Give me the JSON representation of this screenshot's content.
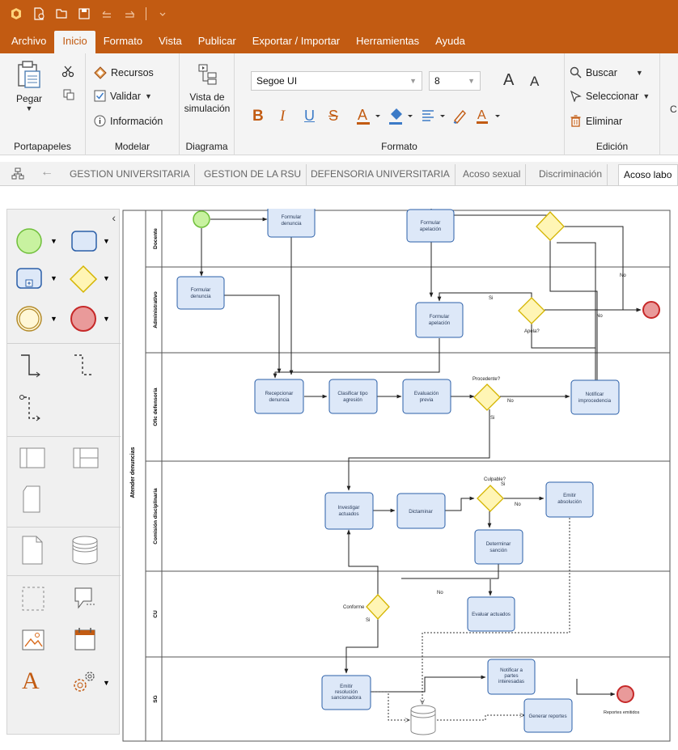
{
  "menu": {
    "items": [
      "Archivo",
      "Inicio",
      "Formato",
      "Vista",
      "Publicar",
      "Exportar / Importar",
      "Herramientas",
      "Ayuda"
    ],
    "active": "Inicio"
  },
  "ribbon": {
    "portapapeles": {
      "paste": "Pegar",
      "label": "Portapapeles"
    },
    "modelar": {
      "recursos": "Recursos",
      "validar": "Validar",
      "informacion": "Información",
      "label": "Modelar"
    },
    "diagrama": {
      "vista_line1": "Vista de",
      "vista_line2": "simulación",
      "label": "Diagrama"
    },
    "formato": {
      "font": "Segoe UI",
      "size": "8",
      "label": "Formato"
    },
    "edicion": {
      "buscar": "Buscar",
      "seleccionar": "Seleccionar",
      "eliminar": "Eliminar",
      "label": "Edición"
    },
    "overflow": "C"
  },
  "tabs": [
    "GESTION UNIVERSITARIA",
    "GESTION DE LA RSU",
    "DEFENSORIA UNIVERSITARIA",
    "Acoso sexual",
    "Discriminación",
    "Acoso labo"
  ],
  "diagram": {
    "pool": "Atender denuncias",
    "lanes": [
      "Docente",
      "Administrativo",
      "Ofic defensoría",
      "Comisión disciplinaria",
      "CU",
      "SG"
    ],
    "tasks": {
      "t1": [
        "Formular",
        "denuncia"
      ],
      "t2": [
        "Formular",
        "apelación"
      ],
      "t3": [
        "Formular",
        "denuncia"
      ],
      "t4": [
        "Formular",
        "apelación"
      ],
      "t5": [
        "Recepcionar",
        "denuncia"
      ],
      "t6": [
        "Clasificar tipo",
        "agresión"
      ],
      "t7": [
        "Evaluación",
        "previa"
      ],
      "t8": [
        "Notificar",
        "improcedencia"
      ],
      "t9": [
        "Investigar",
        "actuados"
      ],
      "t10": [
        "Dictaminar"
      ],
      "t11": [
        "Emitir",
        "absolución"
      ],
      "t12": [
        "Determinar",
        "sanción"
      ],
      "t13": [
        "Evaluar actuados"
      ],
      "t14": [
        "Emitir",
        "resolución",
        "sancionadora"
      ],
      "t15": [
        "Notificar a",
        "partes",
        "interesadas"
      ],
      "t16": [
        "Generar reportes"
      ]
    },
    "labels": {
      "no1": "No",
      "si1": "Si",
      "no2": "No",
      "apela": "Apela?",
      "procedente": "Procedente?",
      "no3": "No",
      "si3": "Si",
      "culpable": "Culpable?",
      "si4": "Si",
      "no4": "No",
      "no5": "No",
      "conforme": "Conforme",
      "si5": "Si",
      "reportes": "Reportes emitidos"
    }
  }
}
